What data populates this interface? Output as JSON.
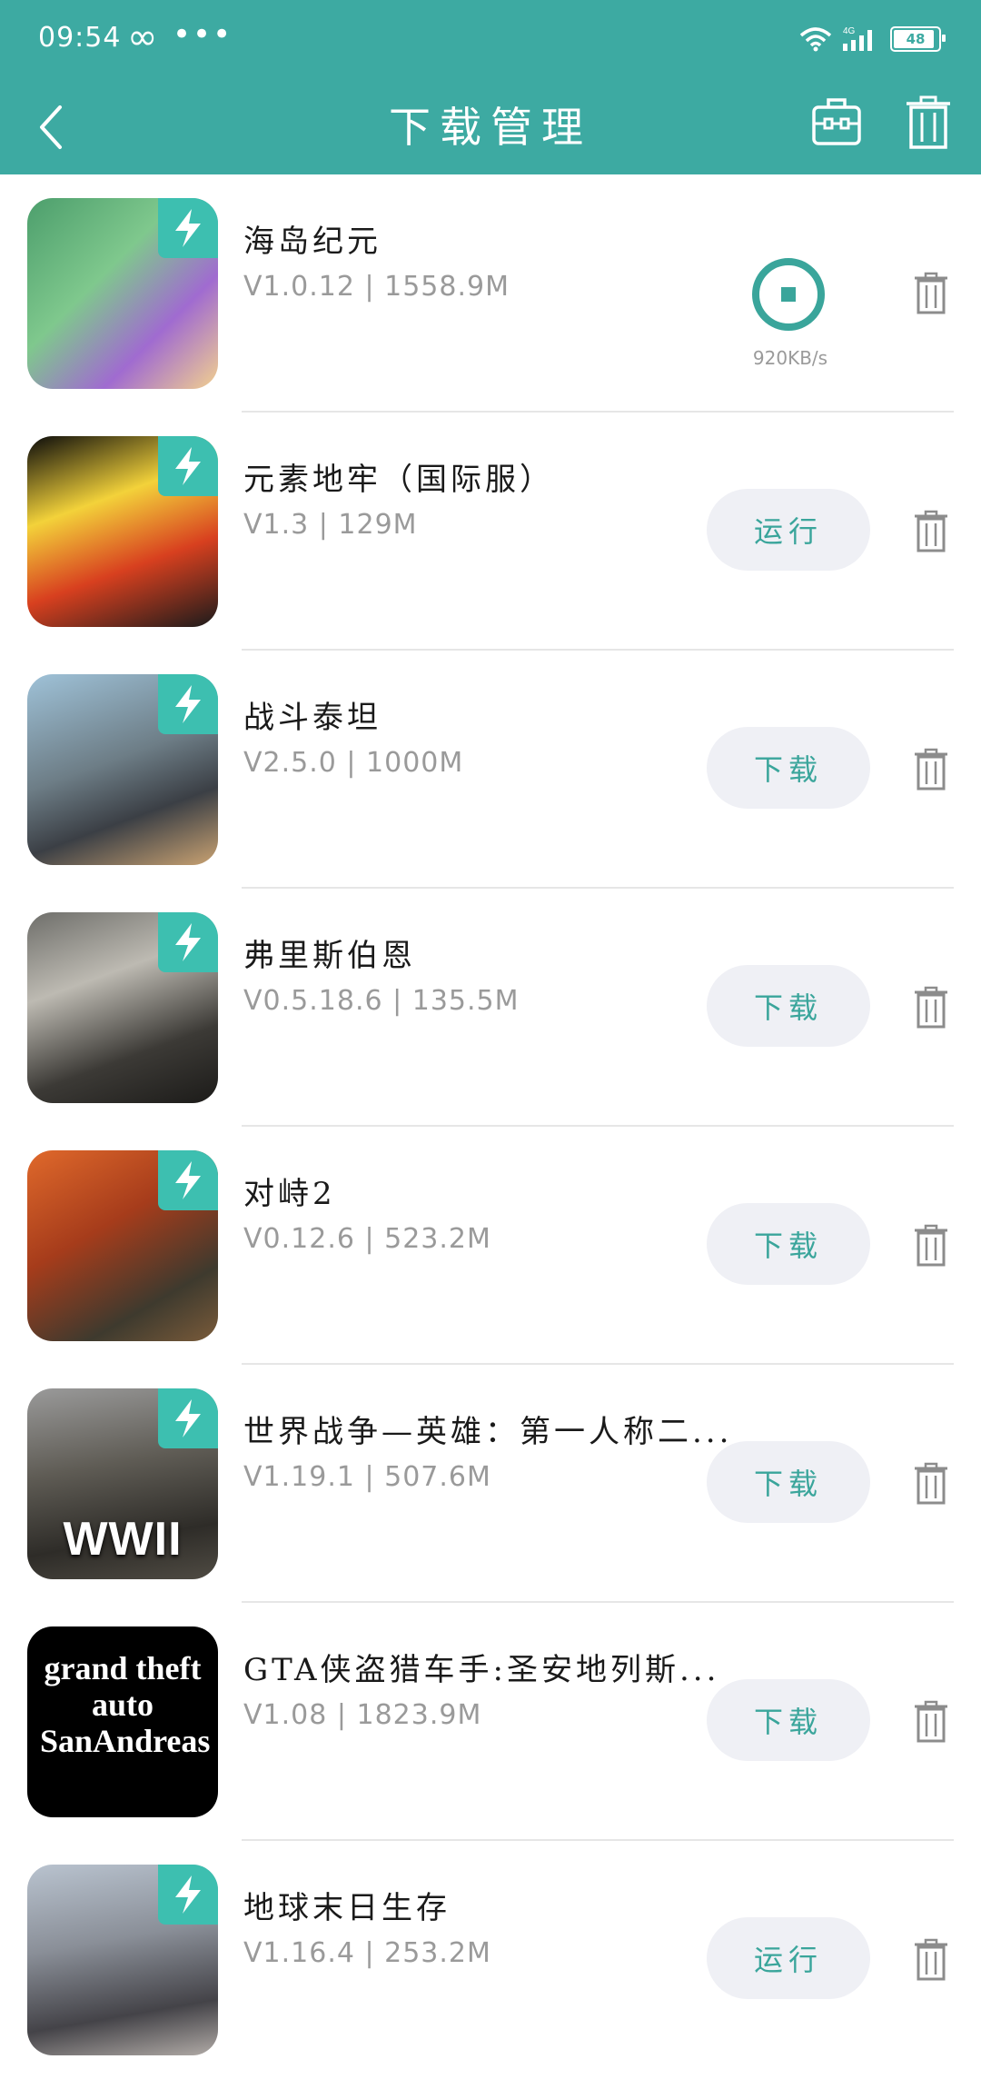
{
  "status_bar": {
    "time": "09:54",
    "infinity": "∞",
    "dots": "•••",
    "network": "4G",
    "battery": "48"
  },
  "header": {
    "title": "下载管理",
    "back_icon": "chevron-left-icon",
    "toolbox_icon": "toolbox-icon",
    "trash_icon": "trash-icon"
  },
  "colors": {
    "accent": "#3daaa2",
    "button_bg": "#eff0f5",
    "button_text": "#3aa59b",
    "bolt": "#3dbfb0"
  },
  "downloads": [
    {
      "name": "海岛纪元",
      "meta": "V1.0.12 | 1558.9M",
      "state": "downloading",
      "speed": "920KB/s",
      "action": ""
    },
    {
      "name": "元素地牢（国际服）",
      "meta": "V1.3 | 129M",
      "state": "installed",
      "action": "运行"
    },
    {
      "name": "战斗泰坦",
      "meta": "V2.5.0 | 1000M",
      "state": "paused",
      "action": "下载"
    },
    {
      "name": "弗里斯伯恩",
      "meta": "V0.5.18.6 | 135.5M",
      "state": "paused",
      "action": "下载"
    },
    {
      "name": "对峙2",
      "meta": "V0.12.6 | 523.2M",
      "state": "paused",
      "action": "下载"
    },
    {
      "name": "世界战争—英雄：第一人称二...",
      "meta": "V1.19.1 | 507.6M",
      "state": "paused",
      "action": "下载"
    },
    {
      "name": "GTA侠盗猎车手:圣安地列斯...",
      "meta": "V1.08 | 1823.9M",
      "state": "paused",
      "action": "下载"
    },
    {
      "name": "地球末日生存",
      "meta": "V1.16.4 | 253.2M",
      "state": "installed",
      "action": "运行"
    }
  ],
  "icon_art": [
    {
      "icon_text": "",
      "label": ""
    },
    {
      "icon_text": "",
      "label": ""
    },
    {
      "icon_text": "",
      "label": ""
    },
    {
      "icon_text": "",
      "label": ""
    },
    {
      "icon_text": "",
      "label": ""
    },
    {
      "icon_text": "WWII",
      "label": ""
    },
    {
      "icon_text": "grand theft auto SanAndreas",
      "label": ""
    },
    {
      "icon_text": "",
      "label": ""
    }
  ]
}
